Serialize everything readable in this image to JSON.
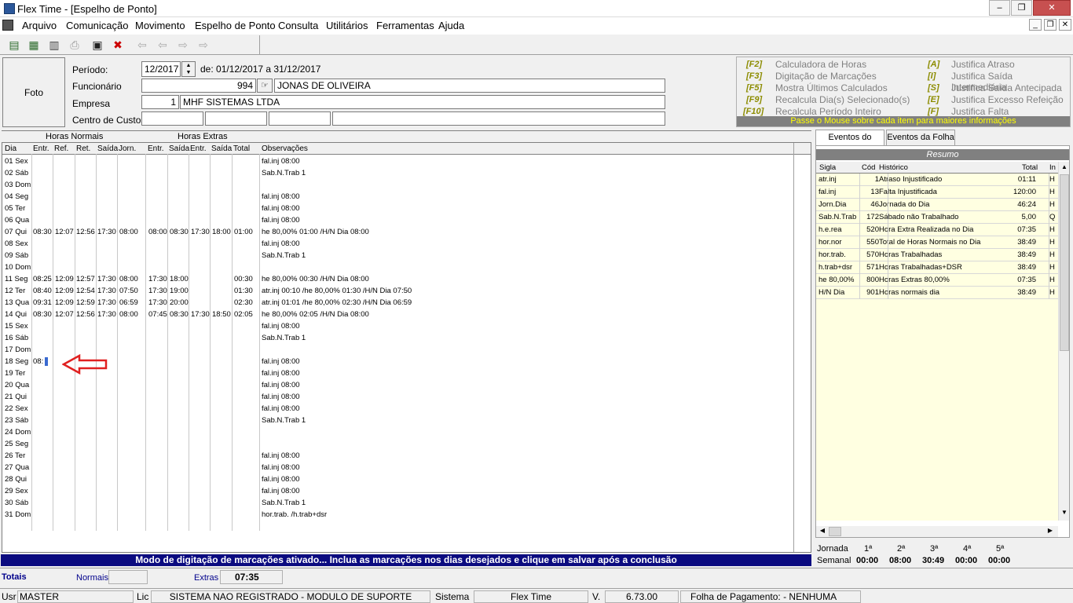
{
  "window": {
    "title": "Flex Time - [Espelho de Ponto]",
    "min": "–",
    "max": "❐",
    "close": "✕"
  },
  "menu": [
    "Arquivo",
    "Comunicação",
    "Movimento",
    "Espelho de Ponto",
    "Consulta",
    "Utilitários",
    "Ferramentas",
    "Ajuda"
  ],
  "header": {
    "foto": "Foto",
    "periodo_label": "Período:",
    "periodo": "12/2017",
    "periodo_range": "de: 01/12/2017 a 31/12/2017",
    "funcionario_label": "Funcionário",
    "funcionario_code": "994",
    "funcionario_name": "JONAS DE OLIVEIRA",
    "empresa_label": "Empresa",
    "empresa_code": "1",
    "empresa_name": "MHF SISTEMAS LTDA",
    "centro_label": "Centro de Custos"
  },
  "shortcuts": [
    {
      "key": "[F2]",
      "label": "Calculadora de Horas"
    },
    {
      "key": "[F3]",
      "label": "Digitação de Marcações"
    },
    {
      "key": "[F5]",
      "label": "Mostra Últimos Calculados"
    },
    {
      "key": "[F9]",
      "label": "Recalcula Dia(s) Selecionado(s)"
    },
    {
      "key": "[F10]",
      "label": "Recalcula Período Inteiro"
    },
    {
      "key": "[A]",
      "label": "Justifica Atraso"
    },
    {
      "key": "[I]",
      "label": "Justifica Saída Intermediária"
    },
    {
      "key": "[S]",
      "label": "Justifica Saída Antecipada"
    },
    {
      "key": "[E]",
      "label": "Justifica Excesso Refeição"
    },
    {
      "key": "[F]",
      "label": "Justifica Falta"
    }
  ],
  "shortcuts_hint": "Passe o Mouse sobre cada item para maiores informações",
  "grid": {
    "group_normais": "Horas Normais",
    "group_extras": "Horas Extras",
    "cols": [
      "Dia",
      "Entr.",
      "Ref.",
      "Ret.",
      "Saída",
      "Jorn.",
      "Entr.",
      "Saída",
      "Entr.",
      "Saída",
      "Total",
      "Observações"
    ],
    "rows": [
      [
        "01 Sex",
        "",
        "",
        "",
        "",
        "",
        "",
        "",
        "",
        "",
        "",
        "fal.inj 08:00"
      ],
      [
        "02 Sáb",
        "",
        "",
        "",
        "",
        "",
        "",
        "",
        "",
        "",
        "",
        "Sab.N.Trab 1"
      ],
      [
        "03 Dom",
        "",
        "",
        "",
        "",
        "",
        "",
        "",
        "",
        "",
        "",
        ""
      ],
      [
        "04 Seg",
        "",
        "",
        "",
        "",
        "",
        "",
        "",
        "",
        "",
        "",
        "fal.inj 08:00"
      ],
      [
        "05 Ter",
        "",
        "",
        "",
        "",
        "",
        "",
        "",
        "",
        "",
        "",
        "fal.inj 08:00"
      ],
      [
        "06 Qua",
        "",
        "",
        "",
        "",
        "",
        "",
        "",
        "",
        "",
        "",
        "fal.inj 08:00"
      ],
      [
        "07 Qui",
        "08:30",
        "12:07",
        "12:56",
        "17:30",
        "08:00",
        "08:00",
        "08:30",
        "17:30",
        "18:00",
        "01:00",
        "he 80,00% 01:00 /H/N Dia 08:00"
      ],
      [
        "08 Sex",
        "",
        "",
        "",
        "",
        "",
        "",
        "",
        "",
        "",
        "",
        "fal.inj 08:00"
      ],
      [
        "09 Sáb",
        "",
        "",
        "",
        "",
        "",
        "",
        "",
        "",
        "",
        "",
        "Sab.N.Trab 1"
      ],
      [
        "10 Dom",
        "",
        "",
        "",
        "",
        "",
        "",
        "",
        "",
        "",
        "",
        ""
      ],
      [
        "11 Seg",
        "08:25",
        "12:09",
        "12:57",
        "17:30",
        "08:00",
        "17:30",
        "18:00",
        "",
        "",
        "00:30",
        "he 80,00% 00:30 /H/N Dia 08:00"
      ],
      [
        "12 Ter",
        "08:40",
        "12:09",
        "12:54",
        "17:30",
        "07:50",
        "17:30",
        "19:00",
        "",
        "",
        "01:30",
        "atr.inj 00:10 /he 80,00% 01:30 /H/N Dia 07:50"
      ],
      [
        "13 Qua",
        "09:31",
        "12:09",
        "12:59",
        "17:30",
        "06:59",
        "17:30",
        "20:00",
        "",
        "",
        "02:30",
        "atr.inj 01:01 /he 80,00% 02:30 /H/N Dia 06:59"
      ],
      [
        "14 Qui",
        "08:30",
        "12:07",
        "12:56",
        "17:30",
        "08:00",
        "07:45",
        "08:30",
        "17:30",
        "18:50",
        "02:05",
        "he 80,00% 02:05 /H/N Dia 08:00"
      ],
      [
        "15 Sex",
        "",
        "",
        "",
        "",
        "",
        "",
        "",
        "",
        "",
        "",
        "fal.inj 08:00"
      ],
      [
        "16 Sáb",
        "",
        "",
        "",
        "",
        "",
        "",
        "",
        "",
        "",
        "",
        "Sab.N.Trab 1"
      ],
      [
        "17 Dom",
        "",
        "",
        "",
        "",
        "",
        "",
        "",
        "",
        "",
        "",
        ""
      ],
      [
        "18 Seg",
        "08:",
        "",
        "",
        "",
        "",
        "",
        "",
        "",
        "",
        "",
        "fal.inj 08:00"
      ],
      [
        "19 Ter",
        "",
        "",
        "",
        "",
        "",
        "",
        "",
        "",
        "",
        "",
        "fal.inj 08:00"
      ],
      [
        "20 Qua",
        "",
        "",
        "",
        "",
        "",
        "",
        "",
        "",
        "",
        "",
        "fal.inj 08:00"
      ],
      [
        "21 Qui",
        "",
        "",
        "",
        "",
        "",
        "",
        "",
        "",
        "",
        "",
        "fal.inj 08:00"
      ],
      [
        "22 Sex",
        "",
        "",
        "",
        "",
        "",
        "",
        "",
        "",
        "",
        "",
        "fal.inj 08:00"
      ],
      [
        "23 Sáb",
        "",
        "",
        "",
        "",
        "",
        "",
        "",
        "",
        "",
        "",
        "Sab.N.Trab 1"
      ],
      [
        "24 Dom",
        "",
        "",
        "",
        "",
        "",
        "",
        "",
        "",
        "",
        "",
        ""
      ],
      [
        "25 Seg",
        "",
        "",
        "",
        "",
        "",
        "",
        "",
        "",
        "",
        "",
        ""
      ],
      [
        "26 Ter",
        "",
        "",
        "",
        "",
        "",
        "",
        "",
        "",
        "",
        "",
        "fal.inj 08:00"
      ],
      [
        "27 Qua",
        "",
        "",
        "",
        "",
        "",
        "",
        "",
        "",
        "",
        "",
        "fal.inj 08:00"
      ],
      [
        "28 Qui",
        "",
        "",
        "",
        "",
        "",
        "",
        "",
        "",
        "",
        "",
        "fal.inj 08:00"
      ],
      [
        "29 Sex",
        "",
        "",
        "",
        "",
        "",
        "",
        "",
        "",
        "",
        "",
        "fal.inj 08:00"
      ],
      [
        "30 Sáb",
        "",
        "",
        "",
        "",
        "",
        "",
        "",
        "",
        "",
        "",
        "Sab.N.Trab 1"
      ],
      [
        "31 Dom",
        "",
        "",
        "",
        "",
        "",
        "",
        "",
        "",
        "",
        "",
        "hor.trab. /h.trab+dsr"
      ]
    ]
  },
  "right": {
    "tabs": [
      "Eventos do Ponto",
      "Eventos da Folha"
    ],
    "resumo": "Resumo",
    "cols": [
      "Sigla",
      "Cód",
      "Histórico",
      "Total",
      "In"
    ],
    "rows": [
      [
        "atr.inj",
        "1",
        "Atraso Injustificado",
        "01:11",
        "H"
      ],
      [
        "fal.inj",
        "13",
        "Falta Injustificada",
        "120:00",
        "H"
      ],
      [
        "Jorn.Dia",
        "46",
        "Jornada do Dia",
        "46:24",
        "H"
      ],
      [
        "Sab.N.Trab",
        "172",
        "Sábado não Trabalhado",
        "5,00",
        "Q"
      ],
      [
        "h.e.rea",
        "520",
        "Hora Extra Realizada no Dia",
        "07:35",
        "H"
      ],
      [
        "hor.nor",
        "550",
        "Total de Horas Normais no Dia",
        "38:49",
        "H"
      ],
      [
        "hor.trab.",
        "570",
        "Horas Trabalhadas",
        "38:49",
        "H"
      ],
      [
        "h.trab+dsr",
        "571",
        "Horas Trabalhadas+DSR",
        "38:49",
        "H"
      ],
      [
        "he 80,00%",
        "800",
        "Horas Extras 80,00%",
        "07:35",
        "H"
      ],
      [
        "H/N Dia",
        "901",
        "Horas normais dia",
        "38:49",
        "H"
      ]
    ],
    "jornada_label": "Jornada",
    "semanal_label": "Semanal",
    "weeks": [
      "1ª",
      "2ª",
      "3ª",
      "4ª",
      "5ª"
    ],
    "semanal": [
      "00:00",
      "08:00",
      "30:49",
      "00:00",
      "00:00"
    ]
  },
  "banner": "Modo de digitação de marcações ativado... Inclua as marcações nos dias desejados e clique em salvar após a conclusão",
  "totals": {
    "label": "Totais",
    "normais_label": "Normais",
    "normais": "",
    "extras_label": "Extras",
    "extras": "07:35"
  },
  "status": {
    "usr_label": "Usr",
    "usr": "MASTER",
    "lic_label": "Lic",
    "lic": "SISTEMA NAO REGISTRADO - MODULO DE SUPORTE",
    "sistema_label": "Sistema",
    "sistema": "Flex Time",
    "v_label": "V.",
    "version": "6.73.00",
    "folha": "Folha de Pagamento:  - NENHUMA"
  },
  "colors": {
    "banner": "#0b0b80",
    "hint_bg": "#808080",
    "hint_fg": "#ffff00",
    "resumo_bg": "#808080",
    "row_yellow": "#ffffe1",
    "arrow": "#e02020"
  }
}
